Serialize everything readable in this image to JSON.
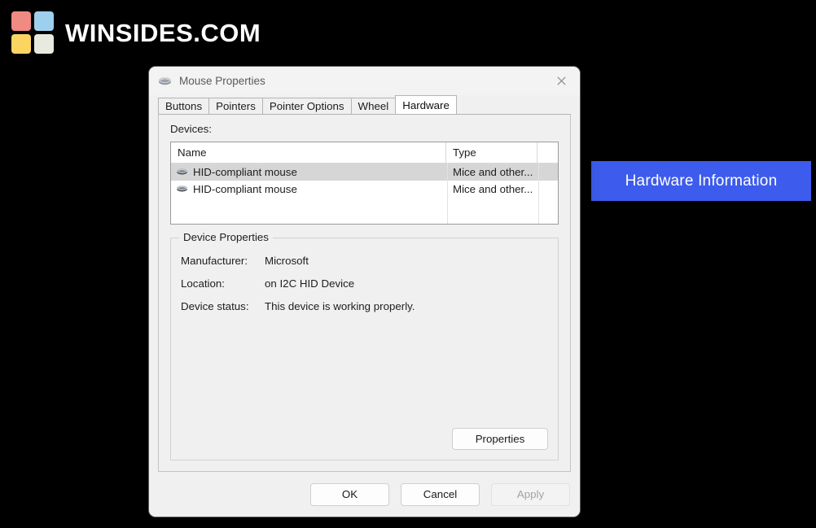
{
  "brand": {
    "name": "WINSIDES.COM",
    "logo_colors": {
      "top_left": "#f08a82",
      "top_right": "#9ed0ee",
      "bottom_left": "#fcd462",
      "bottom_right": "#e9eadf"
    }
  },
  "callout": {
    "text": "Hardware Information",
    "background": "#3d5bec",
    "text_color": "#ffffff"
  },
  "dialog": {
    "title": "Mouse Properties",
    "title_icon": "mouse-icon",
    "close_icon": "close-icon",
    "tabs": [
      {
        "label": "Buttons",
        "active": false
      },
      {
        "label": "Pointers",
        "active": false
      },
      {
        "label": "Pointer Options",
        "active": false
      },
      {
        "label": "Wheel",
        "active": false
      },
      {
        "label": "Hardware",
        "active": true
      }
    ],
    "devices": {
      "label": "Devices:",
      "columns": [
        "Name",
        "Type"
      ],
      "rows": [
        {
          "name": "HID-compliant mouse",
          "type": "Mice and other...",
          "selected": true
        },
        {
          "name": "HID-compliant mouse",
          "type": "Mice and other...",
          "selected": false
        }
      ]
    },
    "device_properties": {
      "legend": "Device Properties",
      "manufacturer_label": "Manufacturer:",
      "manufacturer_value": "Microsoft",
      "location_label": "Location:",
      "location_value": "on I2C HID Device",
      "status_label": "Device status:",
      "status_value": "This device is working properly.",
      "properties_button": "Properties"
    },
    "footer": {
      "ok": "OK",
      "cancel": "Cancel",
      "apply": "Apply",
      "apply_disabled": true
    }
  }
}
